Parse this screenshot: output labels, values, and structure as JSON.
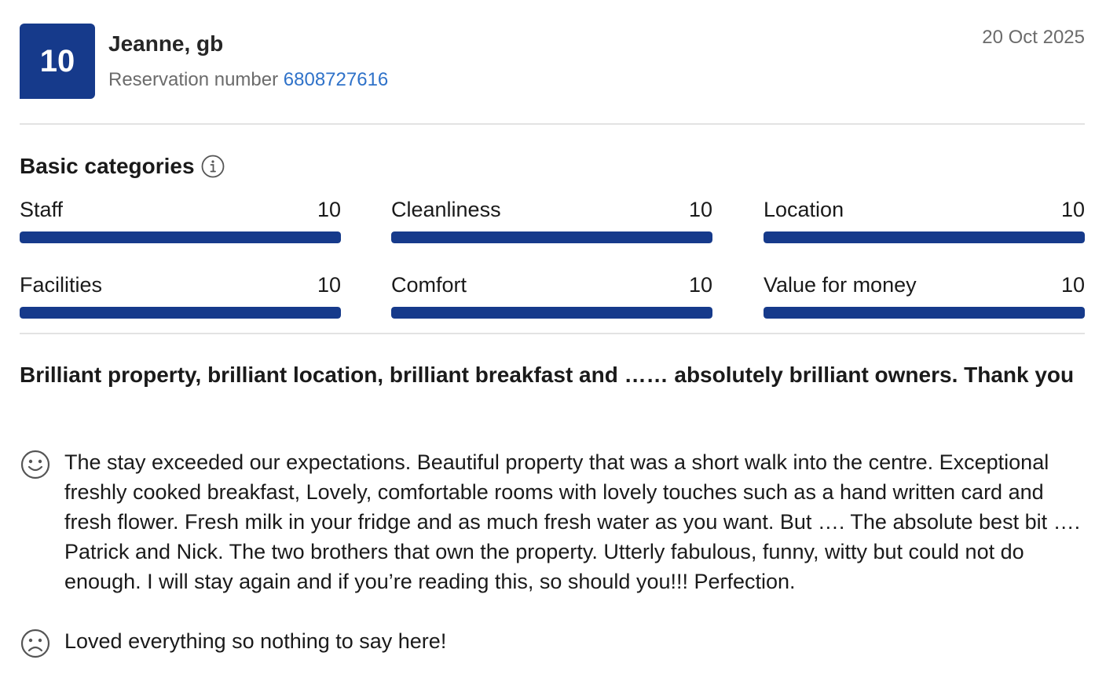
{
  "review": {
    "score": "10",
    "reviewer": "Jeanne, gb",
    "reservation_label": "Reservation number",
    "reservation_number": "6808727616",
    "date": "20 Oct 2025"
  },
  "categories": {
    "heading": "Basic categories",
    "info_icon": "info-icon",
    "items": [
      {
        "label": "Staff",
        "score": "10",
        "fill": 1.0
      },
      {
        "label": "Cleanliness",
        "score": "10",
        "fill": 1.0
      },
      {
        "label": "Location",
        "score": "10",
        "fill": 1.0
      },
      {
        "label": "Facilities",
        "score": "10",
        "fill": 1.0
      },
      {
        "label": "Comfort",
        "score": "10",
        "fill": 1.0
      },
      {
        "label": "Value for money",
        "score": "10",
        "fill": 1.0
      }
    ]
  },
  "content": {
    "title": "Brilliant property, brilliant location, brilliant breakfast and …… absolutely brilliant owners. Thank you",
    "positive_icon": "smile-icon",
    "positive": "The stay exceeded our expectations. Beautiful property that was a short walk into the centre. Exceptional freshly cooked breakfast, Lovely, comfortable rooms with lovely touches such as a hand written card and fresh flower. Fresh milk in your fridge and as much fresh water as you want. But …. The absolute best bit …. Patrick and Nick. The two brothers that own the property. Utterly fabulous, funny, witty but could not do enough. I will stay again and if you’re reading this, so should you!!! Perfection.",
    "negative_icon": "frown-icon",
    "negative": "Loved everything so nothing to say here!"
  },
  "colors": {
    "brand": "#163a8b",
    "link": "#2f72c9",
    "muted": "#6b6b6b"
  }
}
